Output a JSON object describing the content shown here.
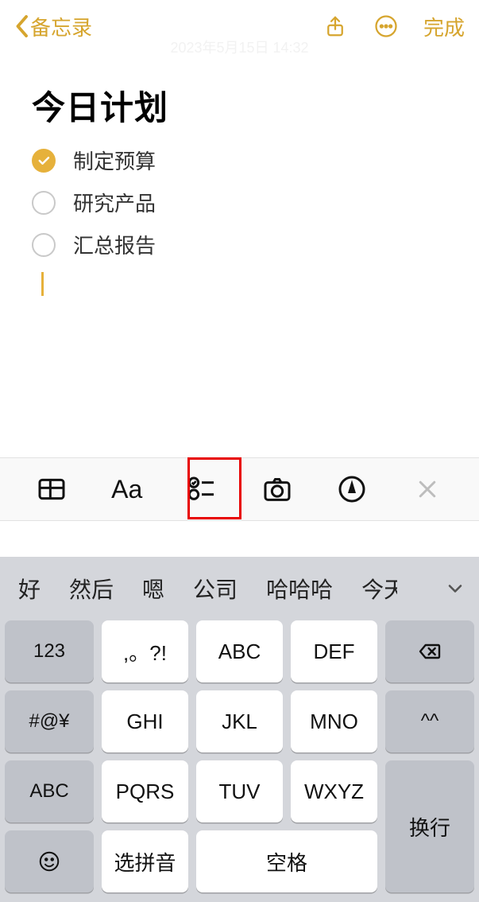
{
  "nav": {
    "back": "备忘录",
    "done": "完成"
  },
  "watermark": "2023年5月15日 14:32",
  "note": {
    "title": "今日计划",
    "items": [
      {
        "text": "制定预算",
        "checked": true
      },
      {
        "text": "研究产品",
        "checked": false
      },
      {
        "text": "汇总报告",
        "checked": false
      }
    ]
  },
  "toolbar": {
    "table": "table-icon",
    "aa": "Aa",
    "checklist": "checklist-icon",
    "camera": "camera-icon",
    "markup": "markup-icon",
    "close": "✕"
  },
  "keyboard": {
    "candidates": [
      "好",
      "然后",
      "嗯",
      "公司",
      "哈哈哈",
      "今天"
    ],
    "keys": {
      "r1": [
        "123",
        ",。?!",
        "ABC",
        "DEF"
      ],
      "r2": [
        "#@¥",
        "GHI",
        "JKL",
        "MNO",
        "^^"
      ],
      "r3": [
        "ABC",
        "PQRS",
        "TUV",
        "WXYZ"
      ],
      "r4_pinyin": "选拼音",
      "r4_space": "空格",
      "enter": "换行",
      "delete": "⌫",
      "emoji": "☺"
    }
  }
}
